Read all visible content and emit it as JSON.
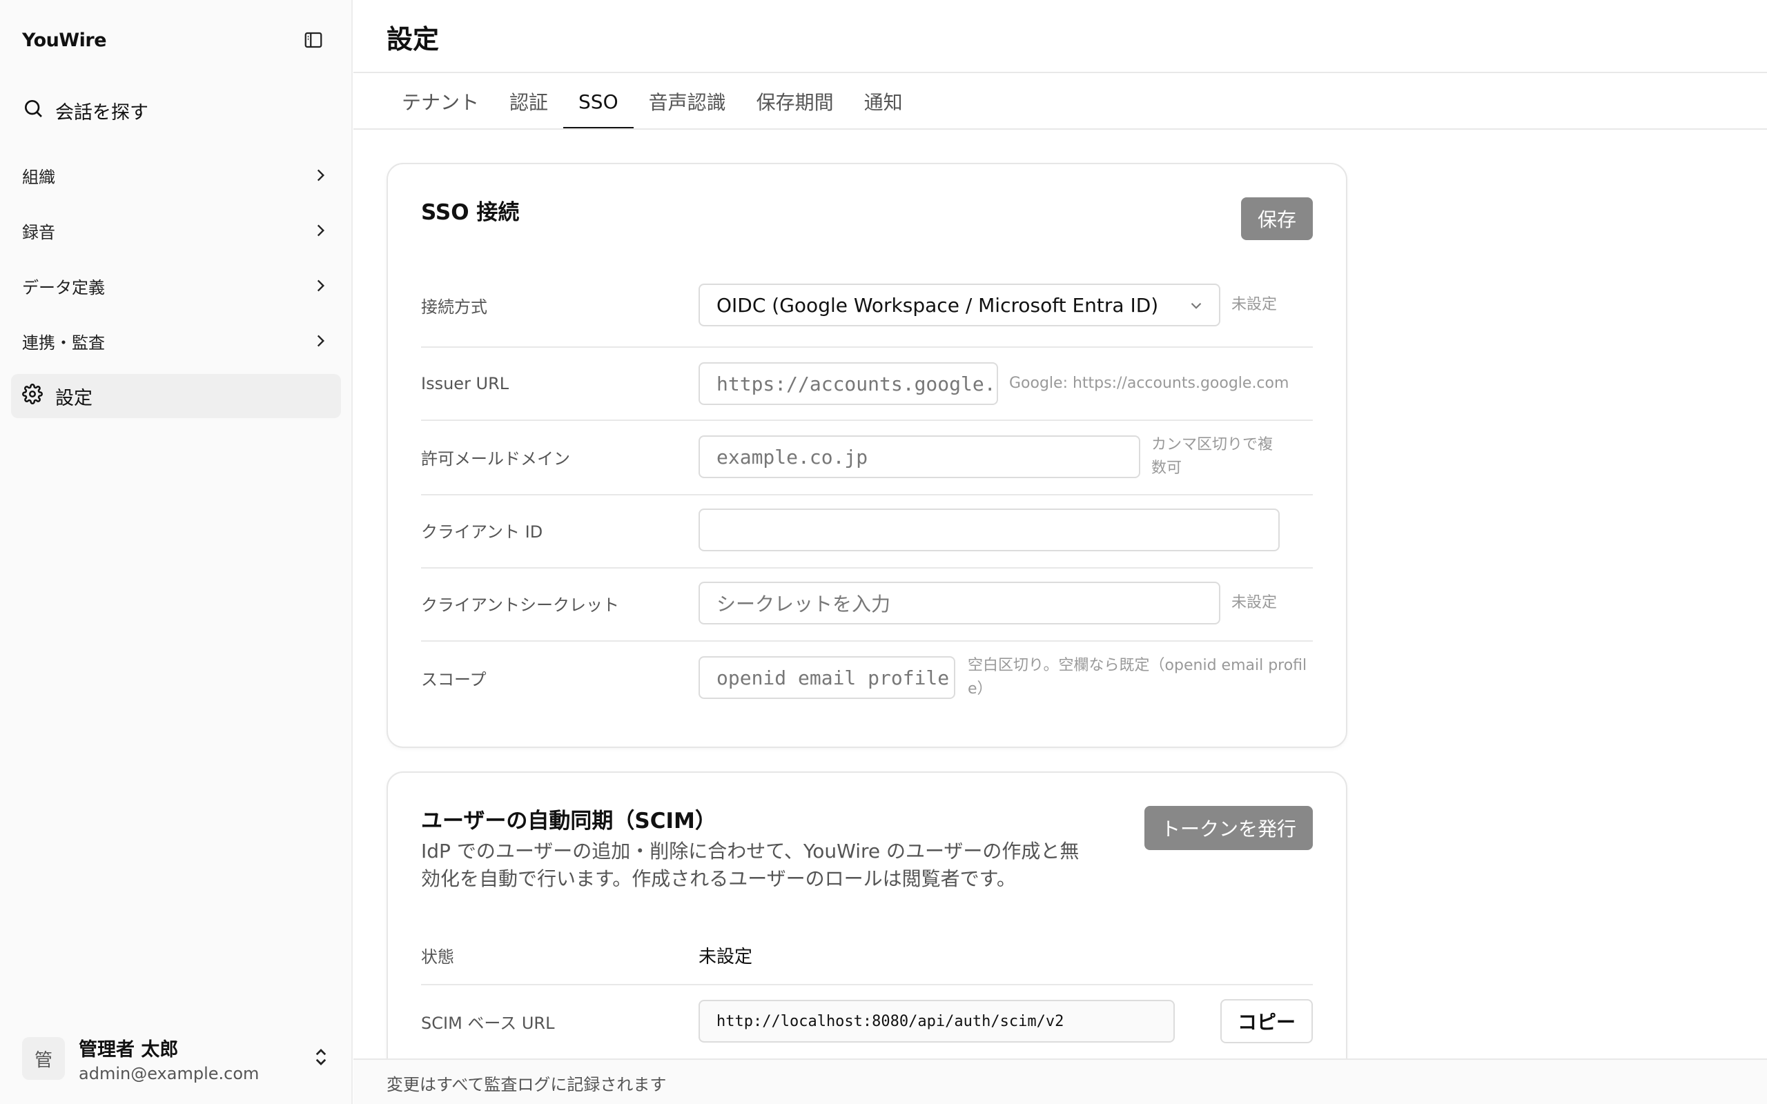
{
  "sidebar": {
    "brand": "YouWire",
    "search_label": "会話を探す",
    "items": [
      {
        "label": "組織"
      },
      {
        "label": "録音"
      },
      {
        "label": "データ定義"
      },
      {
        "label": "連携・監査"
      }
    ],
    "active_item": "設定",
    "user": {
      "avatar": "管",
      "name": "管理者 太郎",
      "email": "admin@example.com"
    }
  },
  "header": {
    "title": "設定",
    "tabs": [
      {
        "label": "テナント"
      },
      {
        "label": "認証"
      },
      {
        "label": "SSO",
        "active": true
      },
      {
        "label": "音声認識"
      },
      {
        "label": "保存期間"
      },
      {
        "label": "通知"
      }
    ]
  },
  "sso": {
    "title": "SSO 接続",
    "save_label": "保存",
    "rows": {
      "method": {
        "label": "接続方式",
        "value": "OIDC (Google Workspace / Microsoft Entra ID)",
        "hint": "未設定"
      },
      "issuer": {
        "label": "Issuer URL",
        "placeholder": "https://accounts.google.com",
        "hint": "Google: https://accounts.google.com"
      },
      "domain": {
        "label": "許可メールドメイン",
        "placeholder": "example.co.jp",
        "hint": "カンマ区切りで複数可"
      },
      "client_id": {
        "label": "クライアント ID",
        "value": ""
      },
      "secret": {
        "label": "クライアントシークレット",
        "placeholder": "シークレットを入力",
        "hint": "未設定"
      },
      "scope": {
        "label": "スコープ",
        "placeholder": "openid email profile",
        "hint": "空白区切り。空欄なら既定（openid email profile）"
      }
    }
  },
  "scim": {
    "title": "ユーザーの自動同期（SCIM）",
    "description": "IdP でのユーザーの追加・削除に合わせて、YouWire のユーザーの作成と無効化を自動で行います。作成されるユーザーのロールは閲覧者です。",
    "token_label": "トークンを発行",
    "status_label": "状態",
    "status_value": "未設定",
    "base_url_label": "SCIM ベース URL",
    "base_url_value": "http://localhost:8080/api/auth/scim/v2",
    "copy_label": "コピー"
  },
  "footer": {
    "text": "変更はすべて監査ログに記録されます"
  },
  "icons": {
    "sidebar_toggle": "sidebar-toggle-icon",
    "search": "search-icon",
    "chevron": "chevron-right-icon",
    "settings": "gear-icon",
    "user_menu": "chevron-up-down-icon",
    "select": "chevron-down-icon"
  }
}
